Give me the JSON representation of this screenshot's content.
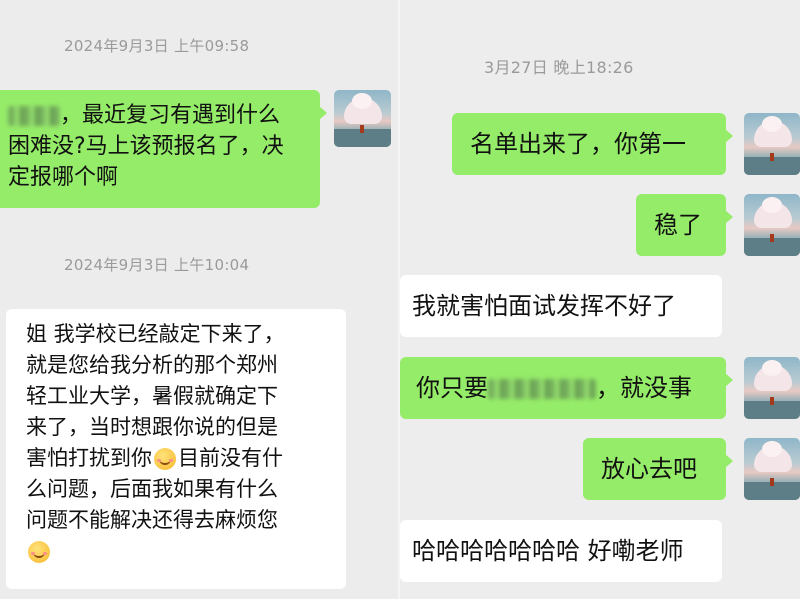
{
  "left": {
    "time1": "2024年9月3日 上午09:58",
    "msg1": [
      "，最近复习有遇到什么",
      "困难没?马上该预报名了，决",
      "定报哪个啊"
    ],
    "time2": "2024年9月3日 上午10:04",
    "msg2": [
      "姐 我学校已经敲定下来了，",
      "就是您给我分析的那个郑州",
      "轻工业大学，暑假就确定下",
      "来了，当时想跟你说的但是",
      "害怕打扰到你",
      "目前没有什",
      "么问题，后面我如果有什么",
      "问题不能解决还得去麻烦您"
    ]
  },
  "right": {
    "time": "3月27日 晚上18:26",
    "msg1": "名单出来了，你第一",
    "msg2": "稳了",
    "msg3": "我就害怕面试发挥不好了",
    "msg4_pre": "你只要",
    "msg4_post": "，就没事",
    "msg5": "放心去吧",
    "msg6": "哈哈哈哈哈哈哈 好嘞老师"
  },
  "icons": {
    "emoji": "smiling-face-icon",
    "avatar": "anime-sky-avatar",
    "blur": "blurred-text"
  },
  "colors": {
    "sent_bubble": "#95ec69",
    "received_bubble": "#ffffff",
    "background": "#ededed",
    "timestamp": "#9a9a9a"
  }
}
